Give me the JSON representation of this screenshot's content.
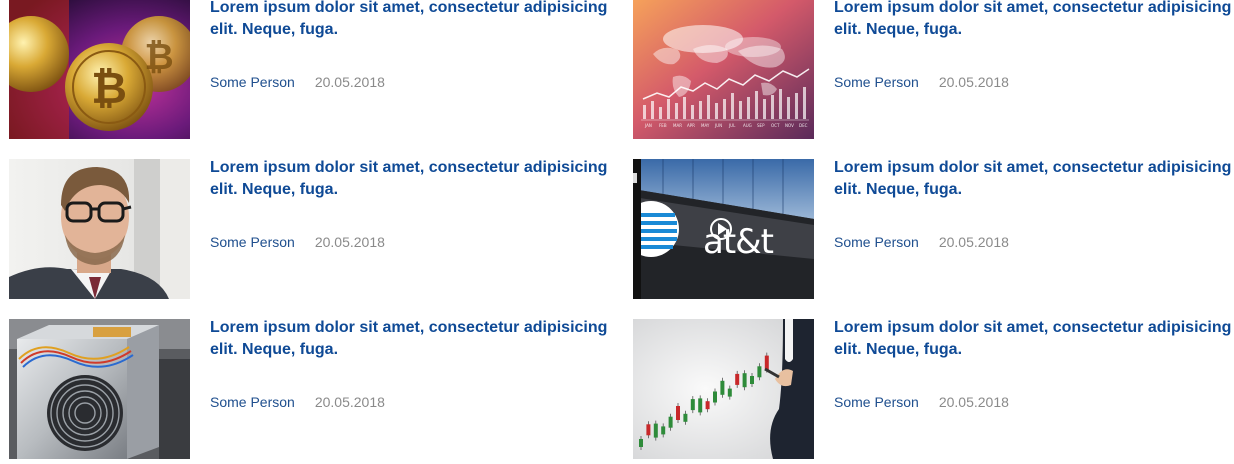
{
  "articles": [
    {
      "title": "Lorem ipsum dolor sit amet, consectetur adipisicing elit. Neque, fuga.",
      "author": "Some Person",
      "date": "20.05.2018",
      "image": "bitcoin-coins-image"
    },
    {
      "title": "Lorem ipsum dolor sit amet, consectetur adipisicing elit. Neque, fuga.",
      "author": "Some Person",
      "date": "20.05.2018",
      "image": "world-map-chart-image",
      "image_labels": [
        "JAN",
        "FEB",
        "MAR",
        "APR",
        "MAY",
        "JUN",
        "JUL",
        "AUG",
        "SEP",
        "OCT",
        "NOV",
        "DEC"
      ]
    },
    {
      "title": "Lorem ipsum dolor sit amet, consectetur adipisicing elit. Neque, fuga.",
      "author": "Some Person",
      "date": "20.05.2018",
      "image": "businessman-glasses-image"
    },
    {
      "title": "Lorem ipsum dolor sit amet, consectetur adipisicing elit. Neque, fuga.",
      "author": "Some Person",
      "date": "20.05.2018",
      "image": "att-building-image",
      "image_text": "at&t"
    },
    {
      "title": "Lorem ipsum dolor sit amet, consectetur adipisicing elit. Neque, fuga.",
      "author": "Some Person",
      "date": "20.05.2018",
      "image": "mining-rig-image"
    },
    {
      "title": "Lorem ipsum dolor sit amet, consectetur adipisicing elit. Neque, fuga.",
      "author": "Some Person",
      "date": "20.05.2018",
      "image": "candlestick-chart-image"
    }
  ],
  "colors": {
    "title": "#0f4a96",
    "author": "#1f4f8e",
    "date": "#8a8a8a"
  }
}
